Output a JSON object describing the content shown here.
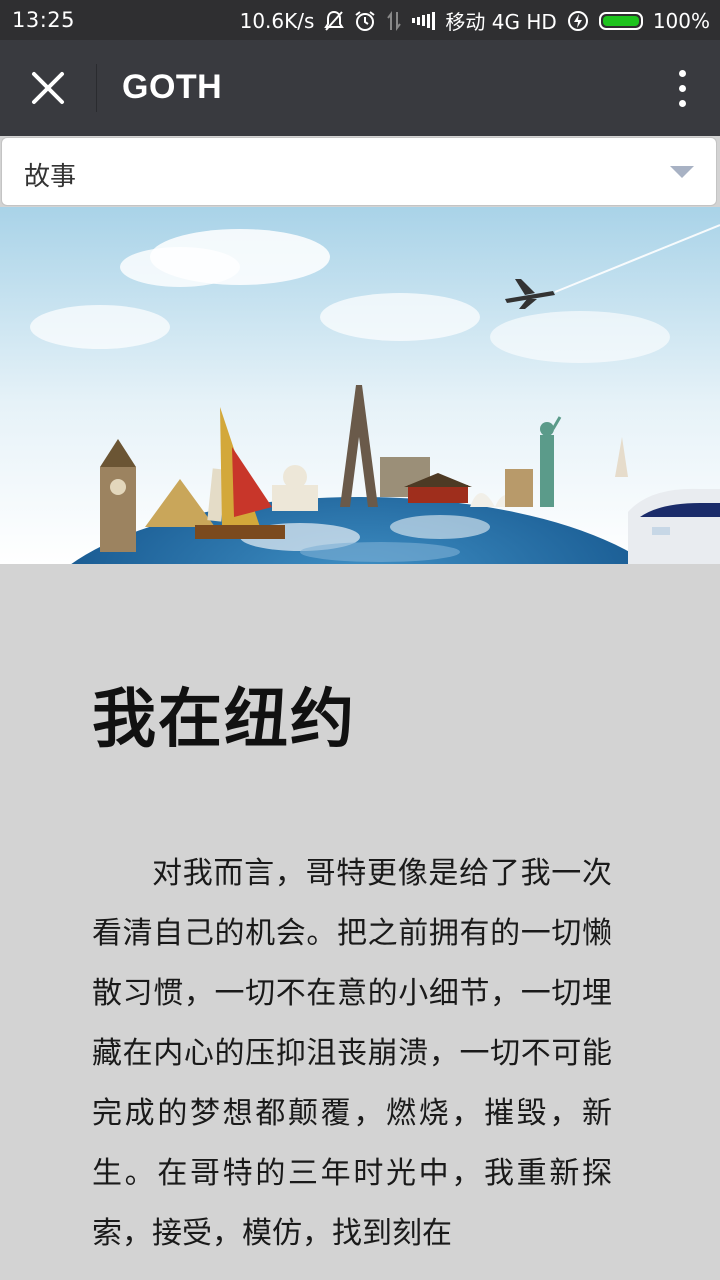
{
  "status_bar": {
    "time": "13:25",
    "net_speed": "10.6K/s",
    "carrier": "移动 4G HD",
    "battery": "100%",
    "battery_level": 1.0
  },
  "app_bar": {
    "title": "GOTH",
    "close_icon": "close-icon",
    "more_icon": "more-vertical-icon"
  },
  "category": {
    "selected": "故事"
  },
  "hero": {
    "description_icon": "travel-landmarks-globe-image"
  },
  "article": {
    "title": "我在纽约",
    "body": "对我而言，哥特更像是给了我一次看清自己的机会。把之前拥有的一切懒散习惯，一切不在意的小细节，一切埋藏在内心的压抑沮丧崩溃，一切不可能完成的梦想都颠覆，燃烧，摧毁，新生。在哥特的三年时光中，我重新探索，接受，模仿，找到刻在"
  },
  "colors": {
    "status_bg": "#2f2f31",
    "app_bar_bg": "#393a3f",
    "page_bg": "#d3d3d3",
    "battery_green": "#1ec31e",
    "dropdown_arrow": "#a8b2c4"
  }
}
